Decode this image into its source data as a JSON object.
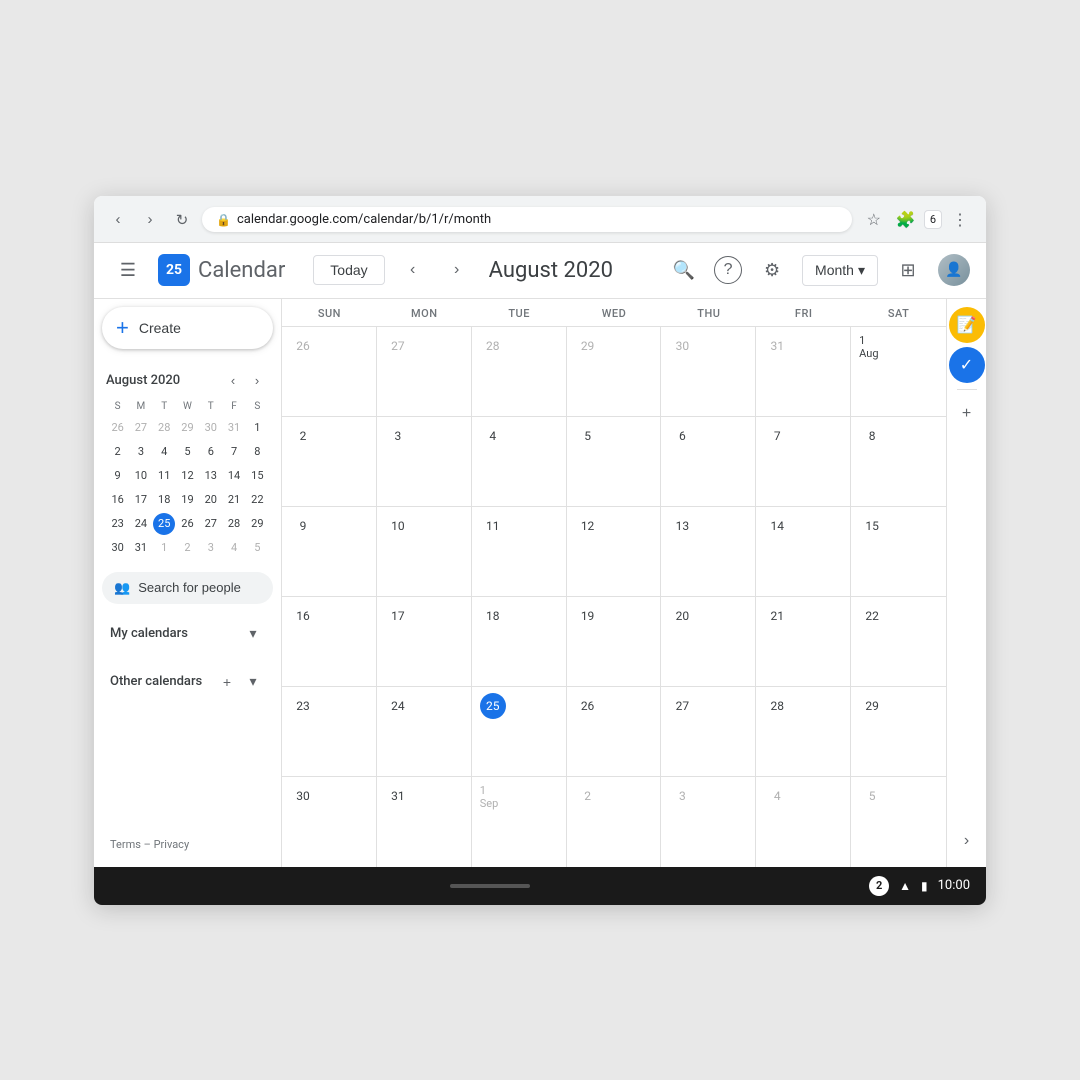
{
  "browser": {
    "url": "calendar.google.com/calendar/b/1/r/month",
    "tab_count": "6"
  },
  "header": {
    "menu_icon": "☰",
    "logo_day": "25",
    "logo_text": "Calendar",
    "today_btn": "Today",
    "month_year": "August 2020",
    "view_mode": "Month",
    "view_dropdown_arrow": "▾"
  },
  "mini_calendar": {
    "title": "August 2020",
    "days_of_week": [
      "S",
      "M",
      "T",
      "W",
      "T",
      "F",
      "S"
    ],
    "weeks": [
      [
        "26",
        "27",
        "28",
        "29",
        "30",
        "31",
        "1"
      ],
      [
        "2",
        "3",
        "4",
        "5",
        "6",
        "7",
        "8"
      ],
      [
        "9",
        "10",
        "11",
        "12",
        "13",
        "14",
        "15"
      ],
      [
        "16",
        "17",
        "18",
        "19",
        "20",
        "21",
        "22"
      ],
      [
        "23",
        "24",
        "25",
        "26",
        "27",
        "28",
        "29"
      ],
      [
        "30",
        "31",
        "1",
        "2",
        "3",
        "4",
        "5"
      ]
    ],
    "today_date": "25",
    "other_month_start": [
      "26",
      "27",
      "28",
      "29",
      "30",
      "31"
    ],
    "other_month_end": [
      "1",
      "2",
      "3",
      "4",
      "5"
    ]
  },
  "sidebar": {
    "create_label": "Create",
    "search_people_placeholder": "Search for people",
    "my_calendars_label": "My calendars",
    "other_calendars_label": "Other calendars",
    "terms_label": "Terms",
    "privacy_label": "Privacy"
  },
  "calendar_grid": {
    "days_of_week": [
      "SUN",
      "MON",
      "TUE",
      "WED",
      "THU",
      "FRI",
      "SAT"
    ],
    "weeks": [
      [
        {
          "num": "26",
          "other": true
        },
        {
          "num": "27",
          "other": true
        },
        {
          "num": "28",
          "other": true
        },
        {
          "num": "29",
          "other": true
        },
        {
          "num": "30",
          "other": true
        },
        {
          "num": "31",
          "other": true
        },
        {
          "num": "1 Aug",
          "first": true
        }
      ],
      [
        {
          "num": "2"
        },
        {
          "num": "3"
        },
        {
          "num": "4"
        },
        {
          "num": "5"
        },
        {
          "num": "6"
        },
        {
          "num": "7"
        },
        {
          "num": "8"
        }
      ],
      [
        {
          "num": "9"
        },
        {
          "num": "10"
        },
        {
          "num": "11"
        },
        {
          "num": "12"
        },
        {
          "num": "13"
        },
        {
          "num": "14"
        },
        {
          "num": "15"
        }
      ],
      [
        {
          "num": "16"
        },
        {
          "num": "17"
        },
        {
          "num": "18"
        },
        {
          "num": "19"
        },
        {
          "num": "20"
        },
        {
          "num": "21"
        },
        {
          "num": "22"
        }
      ],
      [
        {
          "num": "23"
        },
        {
          "num": "24"
        },
        {
          "num": "25",
          "today": true
        },
        {
          "num": "26"
        },
        {
          "num": "27"
        },
        {
          "num": "28"
        },
        {
          "num": "29"
        }
      ],
      [
        {
          "num": "30"
        },
        {
          "num": "31"
        },
        {
          "num": "1 Sep",
          "other": true
        },
        {
          "num": "2",
          "other": true
        },
        {
          "num": "3",
          "other": true
        },
        {
          "num": "4",
          "other": true
        },
        {
          "num": "5",
          "other": true
        }
      ]
    ]
  },
  "bottom_bar": {
    "badge_count": "2",
    "time": "10:00"
  },
  "icons": {
    "back": "‹",
    "forward": "›",
    "reload": "↻",
    "star": "☆",
    "puzzle": "🧩",
    "more_vert": "⋮",
    "search": "🔍",
    "question": "?",
    "settings_gear": "⚙",
    "apps_grid": "⊞",
    "prev_arrow": "‹",
    "next_arrow": "›",
    "chevron_down": "▾",
    "chevron_up": "▴",
    "people_search": "👥",
    "add": "+",
    "lock": "🔒",
    "notes": "📝",
    "tasks_check": "✓",
    "wifi": "▲",
    "battery": "▮",
    "expand_right": "›"
  }
}
